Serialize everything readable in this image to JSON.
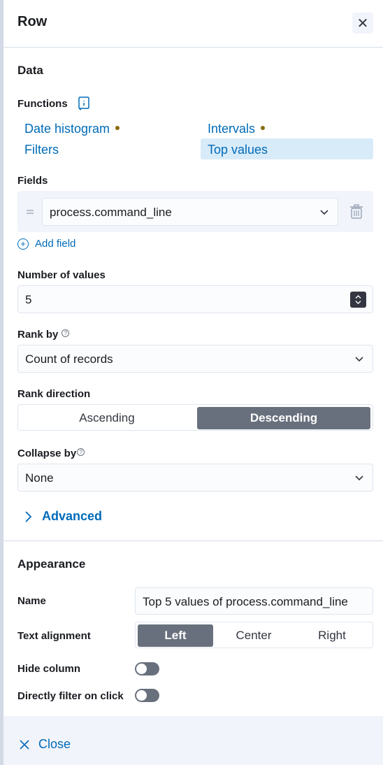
{
  "header": {
    "title": "Row"
  },
  "data_section": {
    "title": "Data",
    "functions_label": "Functions",
    "functions": [
      {
        "label": "Date histogram",
        "has_dot": true
      },
      {
        "label": "Intervals",
        "has_dot": true
      },
      {
        "label": "Filters",
        "has_dot": false
      },
      {
        "label": "Top values",
        "has_dot": false,
        "selected": true
      }
    ],
    "fields_label": "Fields",
    "field_value": "process.command_line",
    "add_field_label": "Add field",
    "number_of_values_label": "Number of values",
    "number_of_values": "5",
    "rank_by_label": "Rank by",
    "rank_by_value": "Count of records",
    "rank_direction_label": "Rank direction",
    "rank_direction_options": [
      "Ascending",
      "Descending"
    ],
    "rank_direction_selected": "Descending",
    "collapse_by_label": "Collapse by",
    "collapse_by_value": "None",
    "advanced_label": "Advanced"
  },
  "appearance": {
    "title": "Appearance",
    "name_label": "Name",
    "name_value": "Top 5 values of process.command_line",
    "text_alignment_label": "Text alignment",
    "text_alignment_options": [
      "Left",
      "Center",
      "Right"
    ],
    "text_alignment_selected": "Left",
    "hide_column_label": "Hide column",
    "hide_column_on": false,
    "directly_filter_label": "Directly filter on click",
    "directly_filter_on": false
  },
  "footer": {
    "close_label": "Close"
  },
  "colors": {
    "link": "#006bb8",
    "selected_bg": "#d8ebf9",
    "active_segment": "#69707d",
    "dot": "#8a6a0a"
  }
}
